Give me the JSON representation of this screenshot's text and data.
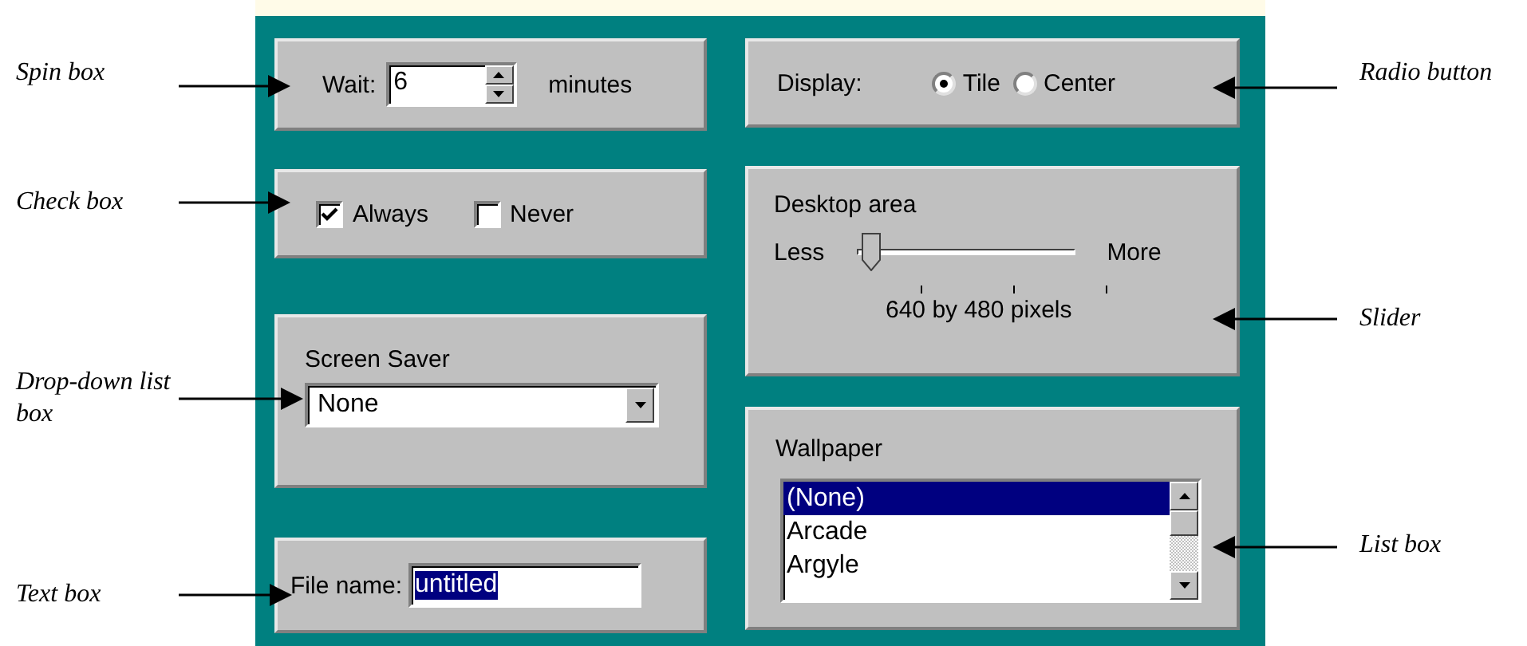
{
  "annotations_left": [
    {
      "label": "Spin box"
    },
    {
      "label": "Check box"
    },
    {
      "label": "Drop-down list box"
    },
    {
      "label": "Text box"
    }
  ],
  "annotations_right": [
    {
      "label": "Radio button"
    },
    {
      "label": "Slider"
    },
    {
      "label": "List box"
    }
  ],
  "spin": {
    "label": "Wait:",
    "value": "6",
    "unit": "minutes"
  },
  "checkboxes": [
    {
      "label": "Always",
      "checked": true
    },
    {
      "label": "Never",
      "checked": false
    }
  ],
  "screen_saver": {
    "label": "Screen Saver",
    "value": "None"
  },
  "file_name": {
    "label": "File name:",
    "value": "untitled"
  },
  "display": {
    "label": "Display:",
    "options": [
      {
        "label": "Tile",
        "selected": true
      },
      {
        "label": "Center",
        "selected": false
      }
    ]
  },
  "desktop_area": {
    "label": "Desktop area",
    "min_label": "Less",
    "max_label": "More",
    "level": 0,
    "reading": "640 by 480 pixels"
  },
  "wallpaper": {
    "label": "Wallpaper",
    "items": [
      {
        "label": "(None)",
        "selected": true
      },
      {
        "label": "Arcade",
        "selected": false
      },
      {
        "label": "Argyle",
        "selected": false
      }
    ]
  }
}
